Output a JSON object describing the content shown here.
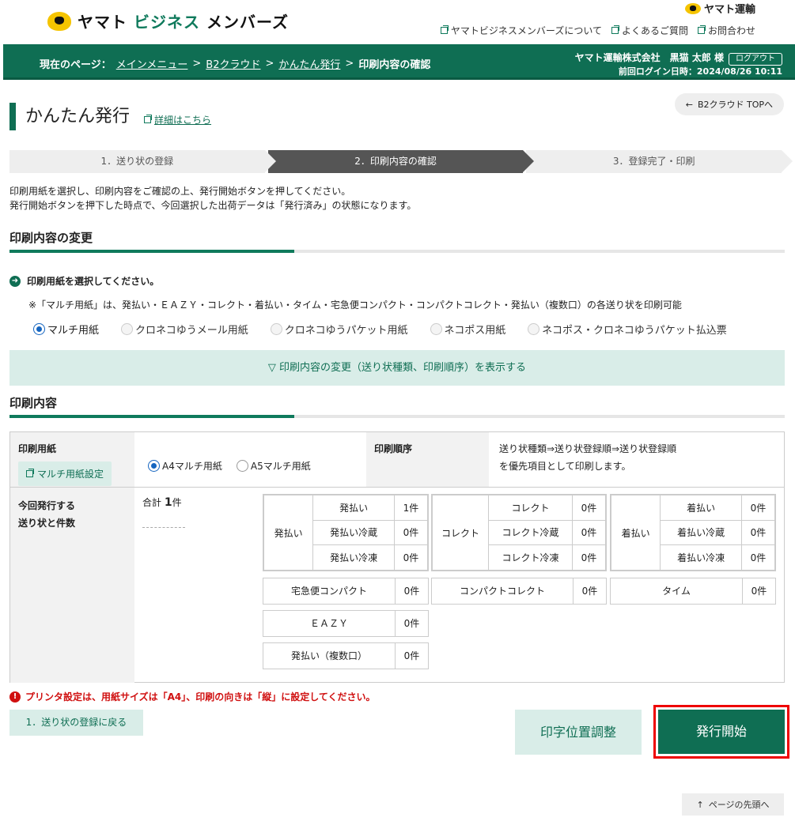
{
  "header": {
    "logo_part1": "ヤマト",
    "logo_part2": "ビジネス",
    "logo_part3": "メンバーズ",
    "corp_mark": "ヤマト運輸",
    "links": [
      "ヤマトビジネスメンバーズについて",
      "よくあるご質問",
      "お問合わせ"
    ]
  },
  "nav": {
    "current_label": "現在のページ：",
    "crumbs": [
      "メインメニュー",
      "B2クラウド",
      "かんたん発行"
    ],
    "current": "印刷内容の確認",
    "company_user": "ヤマト運輸株式会社　黒猫 太郎 様",
    "logout": "ログアウト",
    "last_login": "前回ログイン日時：2024/08/26 10:11"
  },
  "title": {
    "text": "かんたん発行",
    "detail_link": "詳細はこちら",
    "b2_top": "B2クラウド TOPへ"
  },
  "steps": [
    "1．送り状の登録",
    "2．印刷内容の確認",
    "3．登録完了・印刷"
  ],
  "description": [
    "印刷用紙を選択し、印刷内容をご確認の上、発行開始ボタンを押してください。",
    "発行開始ボタンを押下した時点で、今回選択した出荷データは「発行済み」の状態になります。"
  ],
  "change_section": {
    "heading": "印刷内容の変更",
    "question": "印刷用紙を選択してください。",
    "note": "※「マルチ用紙」は、発払い・ＥＡＺＹ・コレクト・着払い・タイム・宅急便コンパクト・コンパクトコレクト・発払い（複数口）の各送り状を印刷可能",
    "options": [
      "マルチ用紙",
      "クロネコゆうメール用紙",
      "クロネコゆうパケット用紙",
      "ネコポス用紙",
      "ネコポス・クロネコゆうパケット払込票"
    ],
    "selected": "マルチ用紙",
    "toggle": "▽ 印刷内容の変更（送り状種類、印刷順序）を表示する"
  },
  "content_section": {
    "heading": "印刷内容",
    "paper_label": "印刷用紙",
    "multi_setting": "マルチ用紙設定",
    "paper_options": [
      "A4マルチ用紙",
      "A5マルチ用紙"
    ],
    "paper_selected": "A4マルチ用紙",
    "order_label": "印刷順序",
    "order_value_1": "送り状種類⇒送り状登録順⇒送り状登録順",
    "order_value_2": "を優先項目として印刷します。",
    "count_label_1": "今回発行する",
    "count_label_2": "送り状と件数",
    "total_prefix": "合計",
    "total_num": "1",
    "total_unit": "件",
    "groups": [
      {
        "name": "発払い",
        "rows": [
          {
            "label": "発払い",
            "count": "1件"
          },
          {
            "label": "発払い冷蔵",
            "count": "0件"
          },
          {
            "label": "発払い冷凍",
            "count": "0件"
          }
        ]
      },
      {
        "name": "コレクト",
        "rows": [
          {
            "label": "コレクト",
            "count": "0件"
          },
          {
            "label": "コレクト冷蔵",
            "count": "0件"
          },
          {
            "label": "コレクト冷凍",
            "count": "0件"
          }
        ]
      },
      {
        "name": "着払い",
        "rows": [
          {
            "label": "着払い",
            "count": "0件"
          },
          {
            "label": "着払い冷蔵",
            "count": "0件"
          },
          {
            "label": "着払い冷凍",
            "count": "0件"
          }
        ]
      }
    ],
    "singles": [
      {
        "label": "宅急便コンパクト",
        "count": "0件"
      },
      {
        "label": "コンパクトコレクト",
        "count": "0件"
      },
      {
        "label": "タイム",
        "count": "0件"
      },
      {
        "label": "ＥＡＺＹ",
        "count": "0件"
      },
      {
        "label": "発払い（複数口）",
        "count": "0件"
      }
    ]
  },
  "footer": {
    "warning": "プリンタ設定は、用紙サイズは「A4」、印刷の向きは「縦」に設定してください。",
    "back": "1．送り状の登録に戻る",
    "adjust": "印字位置調整",
    "issue": "発行開始",
    "page_top": "ページの先頭へ"
  },
  "colors": {
    "brand": "#0f6e53",
    "highlight": "#ee0000"
  }
}
